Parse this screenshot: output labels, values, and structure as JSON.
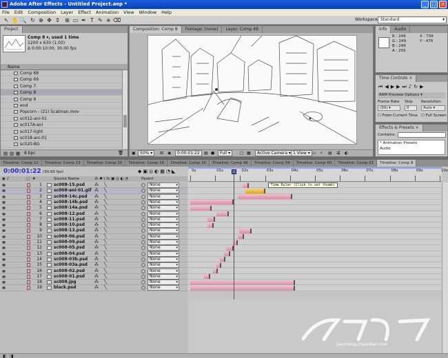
{
  "window": {
    "title": "Adobe After Effects - Untitled Project.aep *"
  },
  "menu": [
    "File",
    "Edit",
    "Composition",
    "Layer",
    "Effect",
    "Animation",
    "View",
    "Window",
    "Help"
  ],
  "workspace": {
    "label": "Workspace:",
    "value": "Standard"
  },
  "project_panel": {
    "tab": "Project",
    "comp_name": "Comp 8 ▾, used 1 time",
    "comp_size": "1200 x 630 (1.00)",
    "comp_duration": "Δ 0:00:10:00, 30.00 fps",
    "column_name": "Name",
    "items": [
      "Comp 68",
      "Comp 69",
      "Comp 7",
      "Comp 8",
      "Comp 9",
      "end",
      "Popcorn - (21) Scatman.mov",
      "sc012-ani-01",
      "sc017A-ani",
      "sc017-light",
      "sc018-ani-01",
      "sc020-BG"
    ],
    "selected_index": 3,
    "bpc": "8 bpc"
  },
  "viewer": {
    "tabs": [
      "Composition: Comp 8",
      "Footage: (none)",
      "Layer: Comp 48"
    ],
    "zoom": "50%",
    "timecode": "0:00:01:22",
    "resolution": "Full",
    "camera": "Active Camera",
    "view": "1 View"
  },
  "info_panel": {
    "tabs": [
      "Info",
      "Audio"
    ],
    "r": "R : 249",
    "g": "G : 249",
    "b": "B : 249",
    "a": "A : 255",
    "x": "X : 739",
    "y": "Y : 476",
    "swatch": "#f9f9f9"
  },
  "time_controls": {
    "tab": "Time Controls",
    "ram_preview": "RAM Preview Options",
    "frame_rate_label": "Frame Rate",
    "skip_label": "Skip",
    "resolution_label": "Resolution",
    "frame_rate": "(30)",
    "skip": "0",
    "resolution": "Auto",
    "from_current": "From Current Time",
    "full_screen": "Full Screen"
  },
  "effects_panel": {
    "tab": "Effects & Presets",
    "contains_label": "Contains:",
    "items": [
      "* Animation Presets",
      "Audio"
    ]
  },
  "timeline": {
    "tabs": [
      "Timeline: Comp 11",
      "Timeline: Comp 13",
      "Timeline: Comp 15",
      "Timeline: Comp 16",
      "Timeline: Comp 20",
      "Timeline: Comp 46",
      "Timeline: Comp 59",
      "Timeline: Comp 60",
      "Timeline: Comp 61",
      "Timeline: Comp 8"
    ],
    "active_tab_index": 9,
    "timecode": "0:00:01:22",
    "fps": "(30.00 fps)",
    "column_source": "Source Name",
    "column_parent": "Parent",
    "ruler": [
      "0s",
      "01s",
      "02s",
      "03s",
      "04s",
      "05s",
      "06s",
      "07s",
      "08s",
      "09s",
      "10s"
    ],
    "current_time_seconds": 1.73,
    "tooltip": "Time Ruler (Click to set thumb)",
    "parent_value": "None",
    "layers": [
      {
        "n": "1",
        "name": "sc008-15.psd",
        "in": 2.1,
        "out": 2.35,
        "sel": false
      },
      {
        "n": "2",
        "name": "sc008-ani-01.gif",
        "in": 2.2,
        "out": 3.0,
        "sel": true
      },
      {
        "n": "3",
        "name": "sc008-14c.psd",
        "in": 1.9,
        "out": 4.1,
        "sel": false
      },
      {
        "n": "4",
        "name": "sc008-14b.psd",
        "in": 0.0,
        "out": 1.75,
        "sel": false
      },
      {
        "n": "5",
        "name": "sc008-14a.psd",
        "in": 0.0,
        "out": 0.85,
        "sel": false
      },
      {
        "n": "6",
        "name": "sc008-12.psd",
        "in": 1.05,
        "out": 1.55,
        "sel": false
      },
      {
        "n": "7",
        "name": "sc008-11.psd",
        "in": 0.7,
        "out": 1.0,
        "sel": false
      },
      {
        "n": "8",
        "name": "sc008-10.psd",
        "in": 0.7,
        "out": 0.95,
        "sel": false
      },
      {
        "n": "9",
        "name": "sc008-13.psd",
        "in": 1.95,
        "out": 2.45,
        "sel": false
      },
      {
        "n": "10",
        "name": "sc008-06.psd",
        "in": 1.9,
        "out": 2.15,
        "sel": false
      },
      {
        "n": "11",
        "name": "sc008-09.psd",
        "in": 1.7,
        "out": 1.9,
        "sel": false
      },
      {
        "n": "12",
        "name": "sc008-05.psd",
        "in": 1.45,
        "out": 1.75,
        "sel": false
      },
      {
        "n": "13",
        "name": "sc008-04.psd",
        "in": 1.35,
        "out": 1.6,
        "sel": false
      },
      {
        "n": "14",
        "name": "sc008-03b.psd",
        "in": 1.2,
        "out": 1.4,
        "sel": false
      },
      {
        "n": "15",
        "name": "sc008-03a.psd",
        "in": 1.05,
        "out": 1.25,
        "sel": false
      },
      {
        "n": "16",
        "name": "sc008-02.psd",
        "in": 0.9,
        "out": 1.1,
        "sel": false
      },
      {
        "n": "17",
        "name": "sc008-01.psd",
        "in": 0.55,
        "out": 0.8,
        "sel": false
      },
      {
        "n": "18",
        "name": "sc008.jpg",
        "in": 0.0,
        "out": 4.2,
        "sel": false
      },
      {
        "n": "19",
        "name": "black.psd",
        "in": 0.0,
        "out": 4.2,
        "sel": false
      }
    ]
  },
  "watermark": {
    "text": "jiaocheng.chazidian.com"
  },
  "colors": {
    "label_pink": "#e2a5b8",
    "bar_pink": "#d88fa2",
    "current_time": "#d42020",
    "selected_bar": "#d6a930"
  }
}
